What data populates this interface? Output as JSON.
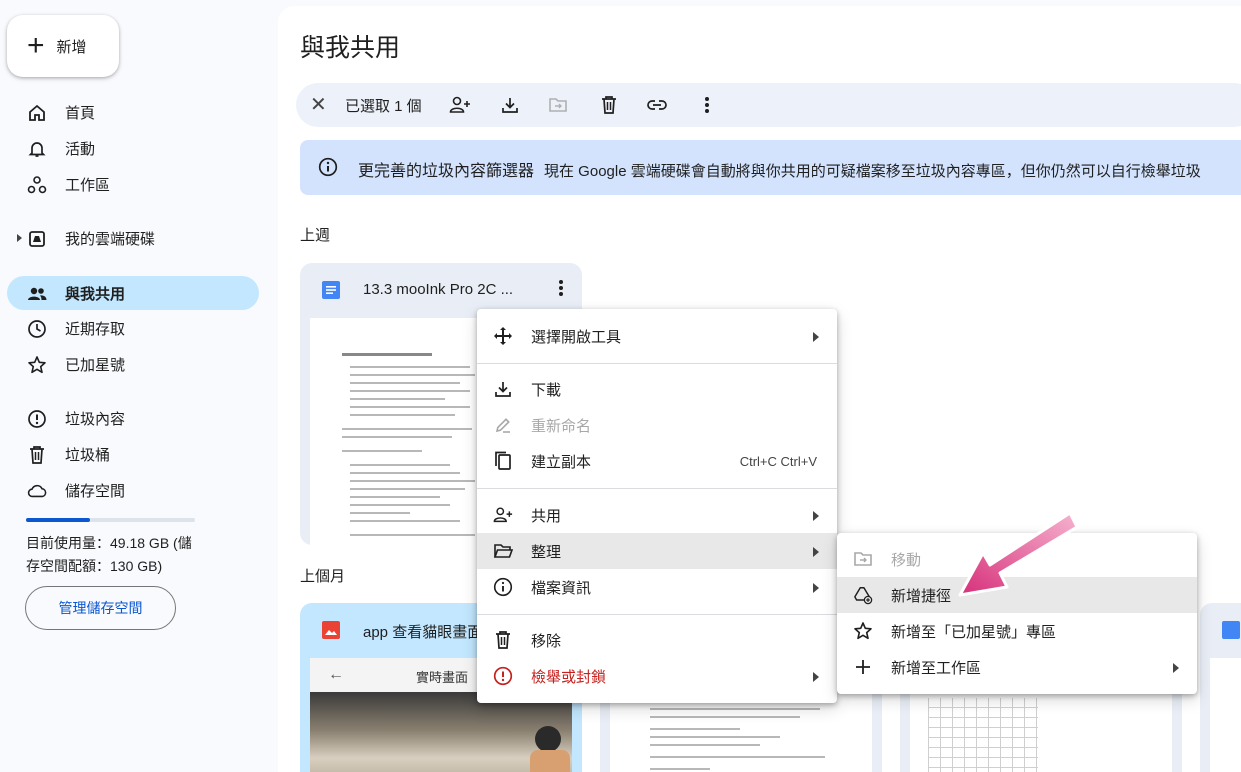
{
  "sidebar": {
    "new_label": "新增",
    "items": [
      {
        "label": "首頁"
      },
      {
        "label": "活動"
      },
      {
        "label": "工作區"
      },
      {
        "label": "我的雲端硬碟"
      },
      {
        "label": "與我共用"
      },
      {
        "label": "近期存取"
      },
      {
        "label": "已加星號"
      },
      {
        "label": "垃圾內容"
      },
      {
        "label": "垃圾桶"
      },
      {
        "label": "儲存空間"
      }
    ],
    "storage_used_fraction": 0.38,
    "storage_line1": "目前使用量：49.18 GB (儲",
    "storage_line2": "存空間配額：130 GB)",
    "manage_storage": "管理儲存空間"
  },
  "main": {
    "title": "與我共用",
    "selection": {
      "count_text": "已選取 1 個"
    },
    "banner": {
      "title": "更完善的垃圾內容篩選器",
      "text": "現在 Google 雲端硬碟會自動將與你共用的可疑檔案移至垃圾內容專區，但你仍然可以自行檢舉垃圾"
    },
    "sections": [
      "上週",
      "上個月"
    ],
    "cards": [
      {
        "name": "13.3 mooInk Pro 2C ..."
      },
      {
        "name": "app 查看貓眼畫面"
      }
    ],
    "thumb_text": {
      "preview_title": "實時畫面"
    }
  },
  "context_menu": {
    "items": [
      {
        "label": "選擇開啟工具"
      },
      {
        "label": "下載"
      },
      {
        "label": "重新命名"
      },
      {
        "label": "建立副本",
        "shortcut": "Ctrl+C Ctrl+V"
      },
      {
        "label": "共用"
      },
      {
        "label": "整理"
      },
      {
        "label": "檔案資訊"
      },
      {
        "label": "移除"
      },
      {
        "label": "檢舉或封鎖"
      }
    ]
  },
  "submenu": {
    "items": [
      {
        "label": "移動"
      },
      {
        "label": "新增捷徑"
      },
      {
        "label": "新增至「已加星號」專區"
      },
      {
        "label": "新增至工作區"
      }
    ]
  },
  "colors": {
    "accent": "#0b57d0",
    "active_nav": "#c2e7ff",
    "banner": "#d3e3fd",
    "arrow": "#d6307a",
    "danger": "#c5221f"
  }
}
